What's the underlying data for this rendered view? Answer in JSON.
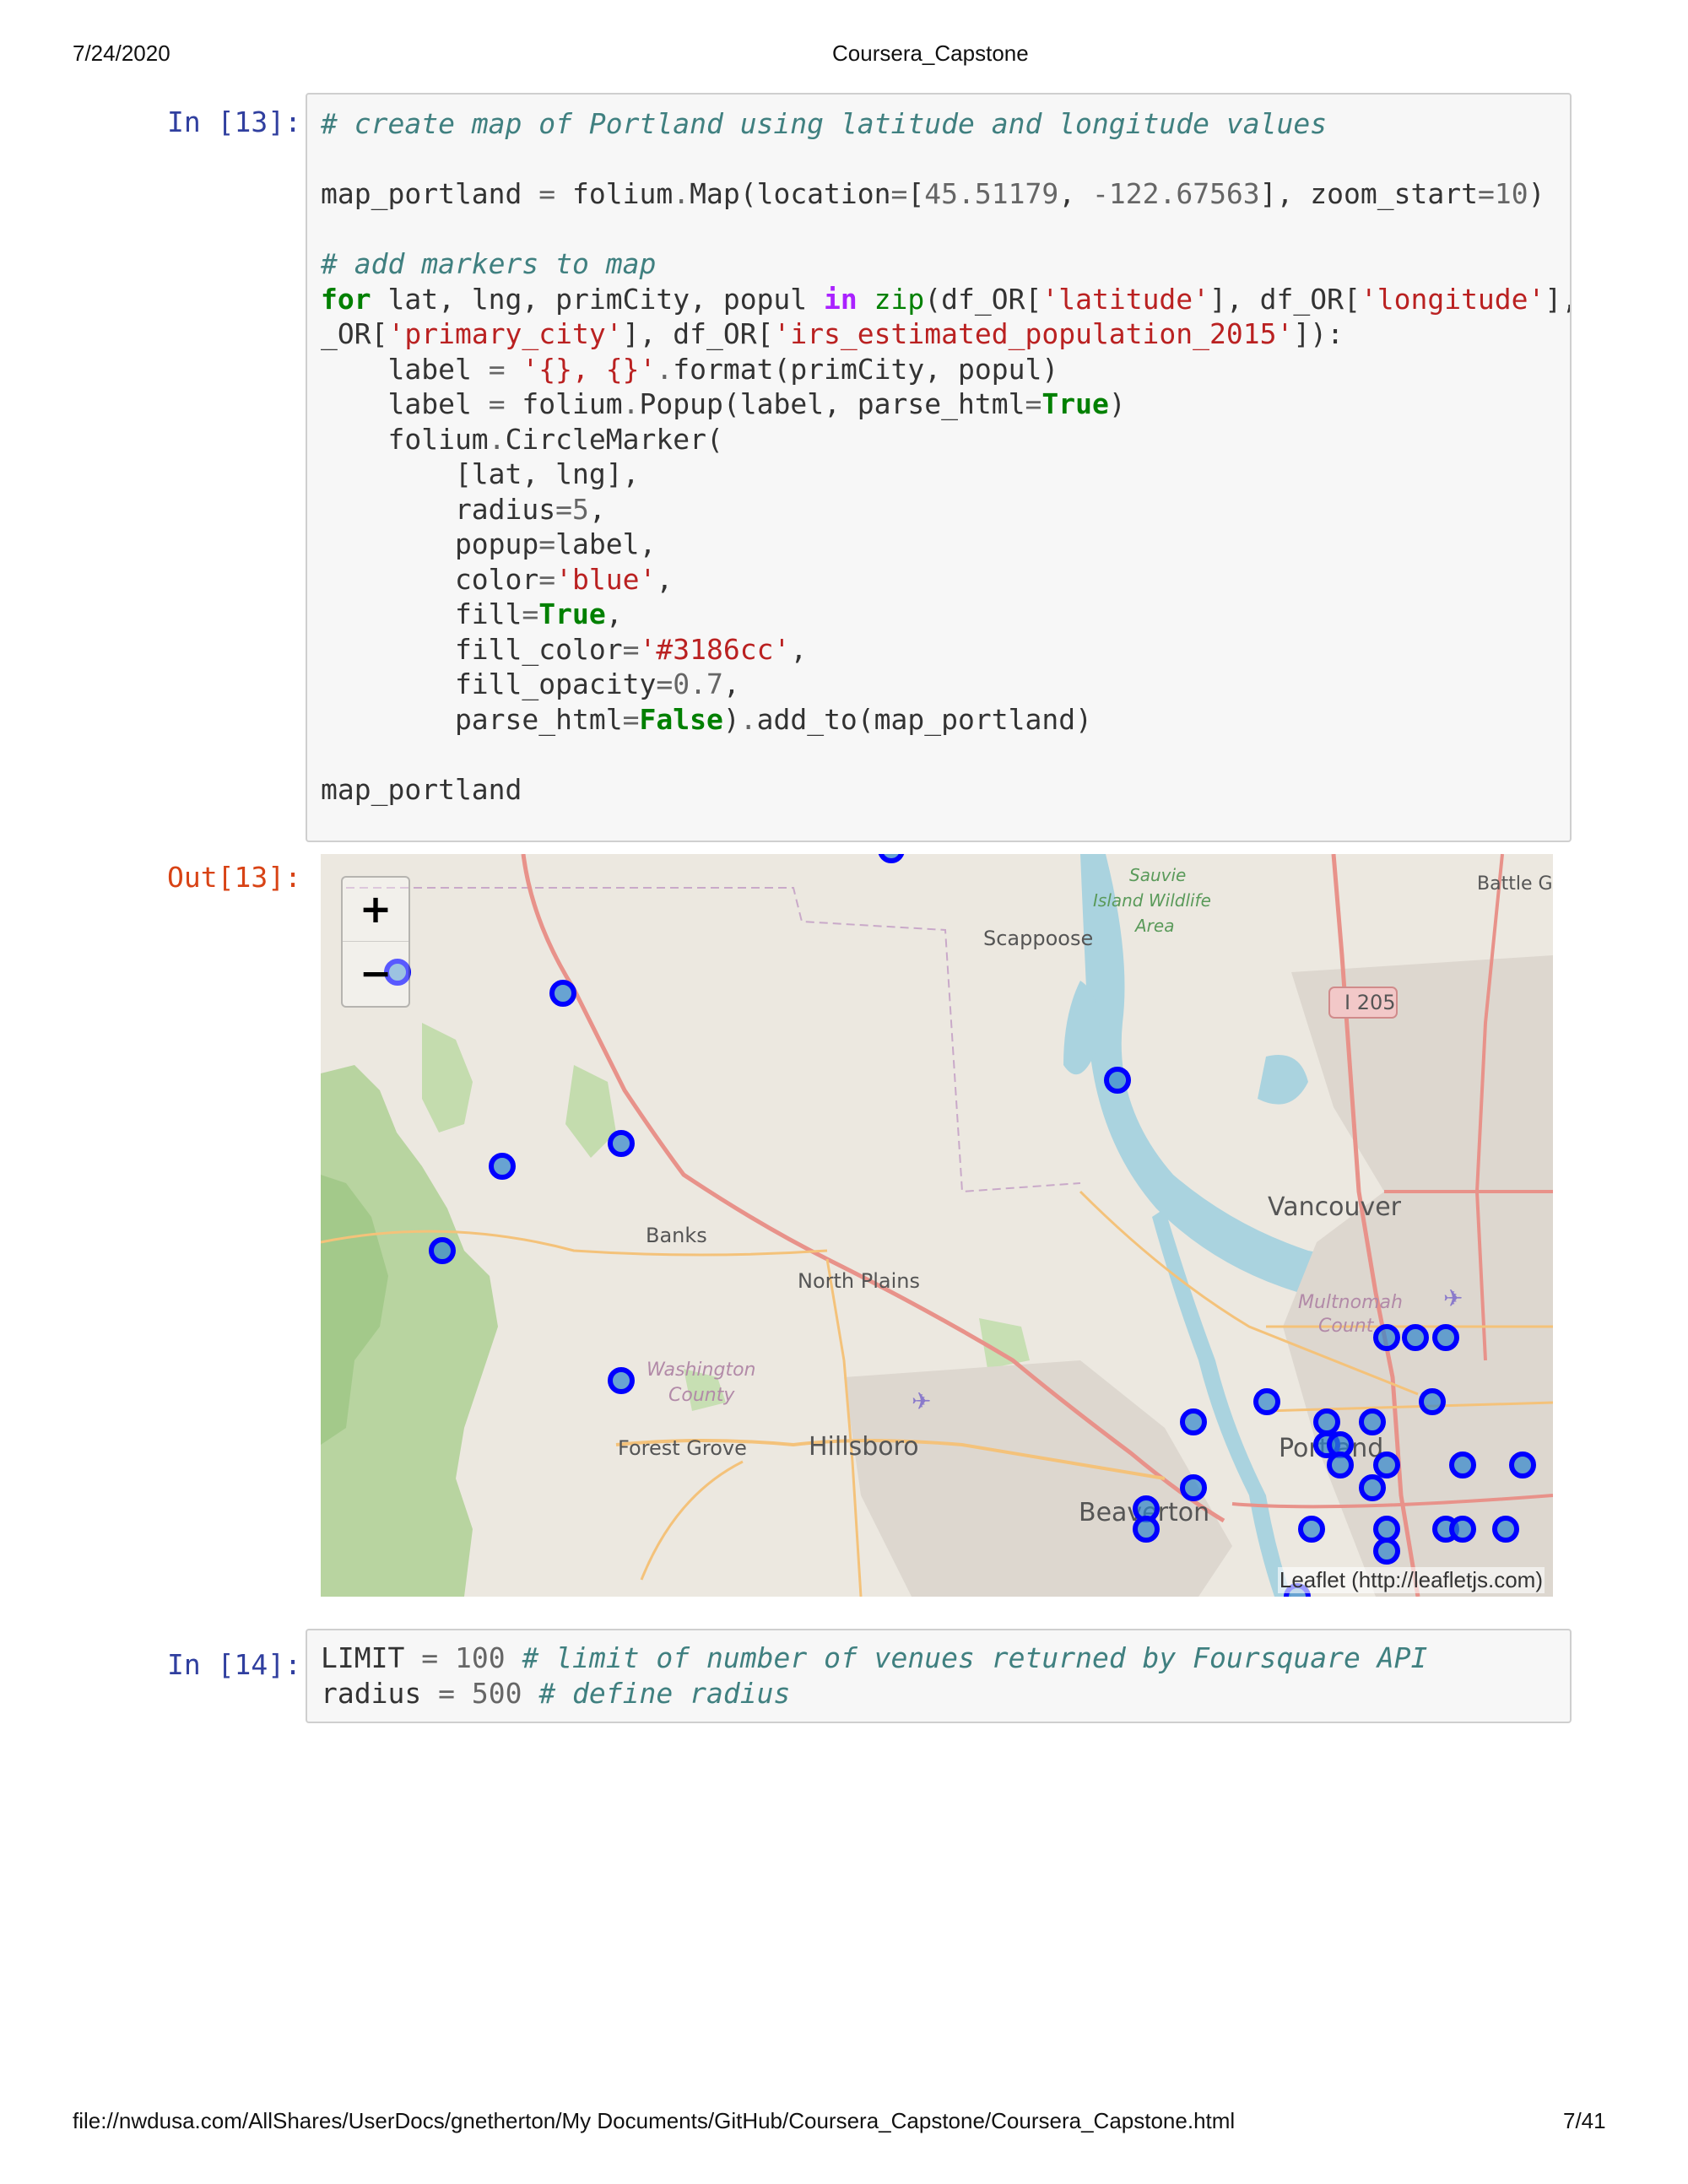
{
  "header": {
    "date": "7/24/2020",
    "title": "Coursera_Capstone"
  },
  "footer": {
    "path": "file://nwdusa.com/AllShares/UserDocs/gnetherton/My Documents/GitHub/Coursera_Capstone/Coursera_Capstone.html",
    "page": "7/41"
  },
  "cell13": {
    "prompt_in": "In [13]:",
    "prompt_out": "Out[13]:",
    "lines": [
      "# create map of Portland using latitude and longitude values",
      "",
      "map_portland = folium.Map(location=[45.51179, -122.67563], zoom_start=10)",
      "",
      "# add markers to map",
      "for lat, lng, primCity, popul in zip(df_OR['latitude'], df_OR['longitude'], df",
      "_OR['primary_city'], df_OR['irs_estimated_population_2015']):",
      "    label = '{}, {}'.format(primCity, popul)",
      "    label = folium.Popup(label, parse_html=True)",
      "    folium.CircleMarker(",
      "        [lat, lng],",
      "        radius=5,",
      "        popup=label,",
      "        color='blue',",
      "        fill=True,",
      "        fill_color='#3186cc',",
      "        fill_opacity=0.7,",
      "        parse_html=False).add_to(map_portland)",
      "",
      "map_portland"
    ]
  },
  "map": {
    "zoom_in": "+",
    "zoom_out": "−",
    "attribution": "Leaflet (http://leafletjs.com)",
    "marker_color": "#0000ff",
    "marker_fill": "#3186cc",
    "labels": {
      "scappoose": "Scappoose",
      "sauvie": [
        "Sauvie",
        "Island Wildlife",
        "Area"
      ],
      "battle": "Battle G",
      "i205": "I 205",
      "vancouver": "Vancouver",
      "banks": "Banks",
      "north_plains": "North Plains",
      "multnomah": [
        "Multnomah",
        "Count"
      ],
      "washington": [
        "Washington",
        "County"
      ],
      "forest_grove": "Forest Grove",
      "hillsboro": "Hillsboro",
      "portland": "Portland",
      "beaverton": "Beaverton"
    }
  },
  "cell14": {
    "prompt_in": "In [14]:",
    "lines": [
      "LIMIT = 100 # limit of number of venues returned by Foursquare API",
      "radius = 500 # define radius"
    ]
  }
}
